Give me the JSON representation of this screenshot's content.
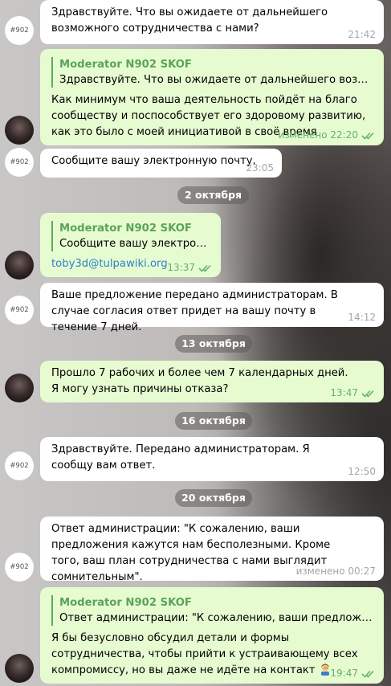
{
  "chat": {
    "avatar_tag_label": "#902",
    "messages": [
      {
        "id": "m1",
        "text": "Здравствуйте. Что вы ожидаете от дальнейшего возможного сотрудничества с нами?",
        "time": "21:42"
      },
      {
        "id": "m2",
        "reply_name": "Moderator N902 SKOF",
        "reply_text": "Здравствуйте. Что вы ожидаете от дальнейшего возможного сотрудничества с нами?",
        "text": "Как минимум что ваша деятельность пойдёт на благо сообществу и поспособствует его здоровому развитию, как это было с моей инициативой в своё время",
        "time": "изменено 22:20"
      },
      {
        "id": "m3",
        "text": "Сообщите вашу электронную почту.",
        "time": "23:05"
      },
      {
        "id": "m4",
        "reply_name": "Moderator N902 SKOF",
        "reply_text": "Сообщите вашу электронную почту.",
        "link": "toby3d@tulpawiki.org",
        "time": "13:37"
      },
      {
        "id": "m5",
        "text": "Ваше предложение передано администраторам. В случае согласия ответ придет на вашу почту в течение 7 дней.",
        "time": "14:12"
      },
      {
        "id": "m6",
        "text": "Прошло 7 рабочих и более чем 7 календарных дней. Я могу узнать причины отказа?",
        "time": "13:47"
      },
      {
        "id": "m7",
        "text": "Здравствуйте. Передано администраторам. Я сообщу вам ответ.",
        "time": "12:50"
      },
      {
        "id": "m8",
        "text": "Ответ администрации: \"К сожалению, ваши предложения кажутся нам бесполезными. Кроме того, ваш план сотрудничества с нами выглядит сомнительным\".",
        "time": "изменено 00:27"
      },
      {
        "id": "m9",
        "reply_name": "Moderator N902 SKOF",
        "reply_text": "Ответ администрации: \"К сожалению, ваши предложения кажутся нам бесполезными.",
        "text": "Я бы безусловно обсудил детали и формы сотрудничества, чтобы прийти к устраивающему всех компромиссу, но вы даже не идёте на контакт",
        "time": "19:47"
      }
    ],
    "dates": [
      "2 октября",
      "13 октября",
      "16 октября",
      "20 октября"
    ]
  },
  "colors": {
    "incoming_bg": "#ffffff",
    "outgoing_bg": "#e7fbd1",
    "reply_accent": "#5cab5a",
    "link": "#2a82c9",
    "check_green": "#63b26c"
  },
  "icons": {
    "read_receipt": "double-check-icon",
    "emoji": "man-facepalming-emoji"
  }
}
